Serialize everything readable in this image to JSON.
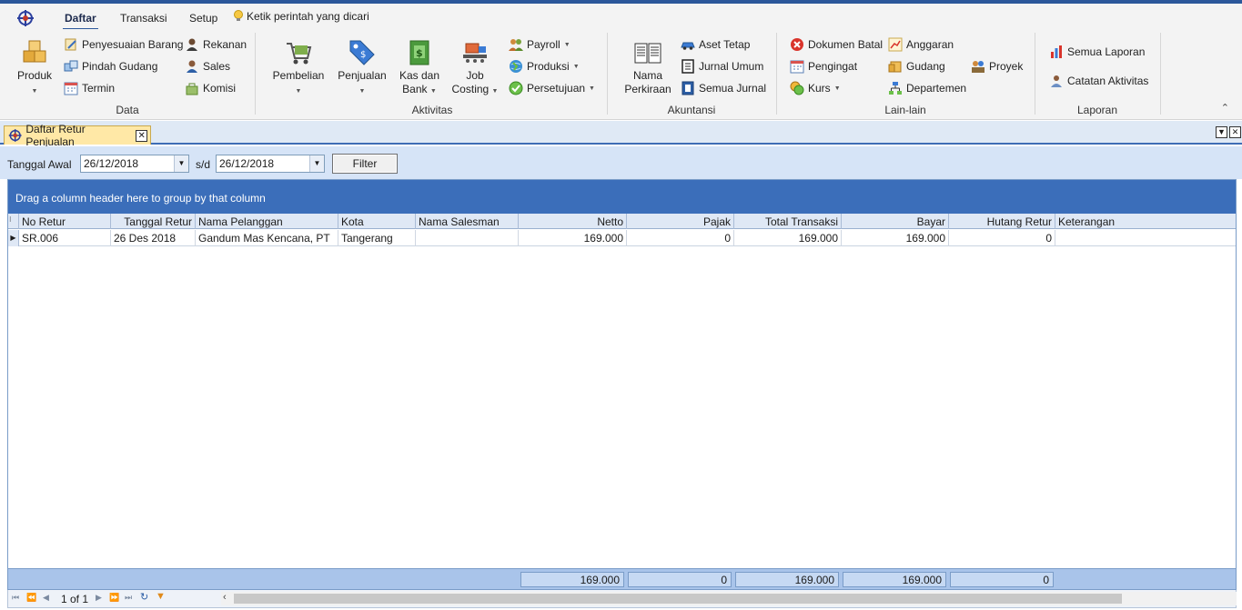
{
  "ribbon": {
    "tabs": [
      "Daftar",
      "Transaksi",
      "Setup"
    ],
    "tell_me": "Ketik perintah yang dicari",
    "groups": {
      "data": {
        "label": "Data",
        "produk": "Produk",
        "penyesuaian_barang": "Penyesuaian Barang",
        "pindah_gudang": "Pindah Gudang",
        "termin": "Termin",
        "rekanan": "Rekanan",
        "sales": "Sales",
        "komisi": "Komisi"
      },
      "aktivitas": {
        "label": "Aktivitas",
        "pembelian": "Pembelian",
        "penjualan": "Penjualan",
        "kas_line1": "Kas dan",
        "kas_line2": "Bank",
        "job_line1": "Job",
        "job_line2": "Costing",
        "payroll": "Payroll",
        "produksi": "Produksi",
        "persetujuan": "Persetujuan"
      },
      "akuntansi": {
        "label": "Akuntansi",
        "nama_line1": "Nama",
        "nama_line2": "Perkiraan",
        "aset_tetap": "Aset Tetap",
        "jurnal_umum": "Jurnal Umum",
        "semua_jurnal": "Semua Jurnal"
      },
      "lainlain": {
        "label": "Lain-lain",
        "dokumen_batal": "Dokumen Batal",
        "pengingat": "Pengingat",
        "kurs": "Kurs",
        "anggaran": "Anggaran",
        "gudang": "Gudang",
        "departemen": "Departemen",
        "proyek": "Proyek"
      },
      "laporan": {
        "label": "Laporan",
        "semua_laporan": "Semua Laporan",
        "catatan_aktivitas": "Catatan Aktivitas"
      }
    }
  },
  "document": {
    "tab_title": "Daftar Retur Penjualan"
  },
  "filter": {
    "start_label": "Tanggal Awal",
    "start_value": "26/12/2018",
    "sep_label": "s/d",
    "end_value": "26/12/2018",
    "button": "Filter"
  },
  "grid": {
    "group_panel_text": "Drag a column header here to group by that column",
    "columns": [
      "No Retur",
      "Tanggal Retur",
      "Nama Pelanggan",
      "Kota",
      "Nama Salesman",
      "Netto",
      "Pajak",
      "Total Transaksi",
      "Bayar",
      "Hutang Retur",
      "Keterangan"
    ],
    "rows": [
      [
        "SR.006",
        "26 Des 2018",
        "Gandum Mas Kencana, PT",
        "Tangerang",
        "",
        "169.000",
        "0",
        "169.000",
        "169.000",
        "0",
        ""
      ]
    ],
    "totals": {
      "netto": "169.000",
      "pajak": "0",
      "total_transaksi": "169.000",
      "bayar": "169.000",
      "hutang_retur": "0"
    }
  },
  "navigator": {
    "page_text": "1 of 1"
  }
}
